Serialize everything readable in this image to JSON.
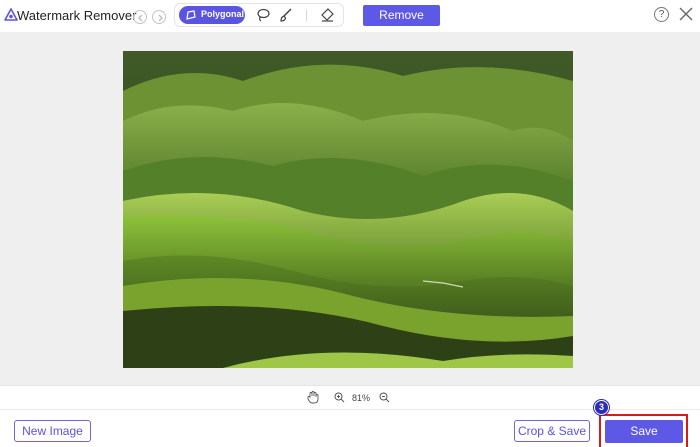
{
  "app": {
    "title": "Watermark Remover"
  },
  "toolbar": {
    "tools": [
      {
        "name": "Polygonal",
        "icon": "polygonal-icon",
        "active": true
      },
      {
        "name": "",
        "icon": "lasso-icon",
        "active": false
      },
      {
        "name": "",
        "icon": "brush-icon",
        "active": false
      },
      {
        "name": "",
        "icon": "eraser-icon",
        "active": false
      }
    ],
    "remove_label": "Remove",
    "help_label": "?"
  },
  "zoom": {
    "level": "81%"
  },
  "footer": {
    "new_image_label": "New Image",
    "crop_save_label": "Crop & Save",
    "save_label": "Save",
    "step_badge": "3"
  },
  "colors": {
    "accent": "#5e58e6",
    "highlight": "#d41c1c",
    "badge": "#2c2cb8"
  }
}
